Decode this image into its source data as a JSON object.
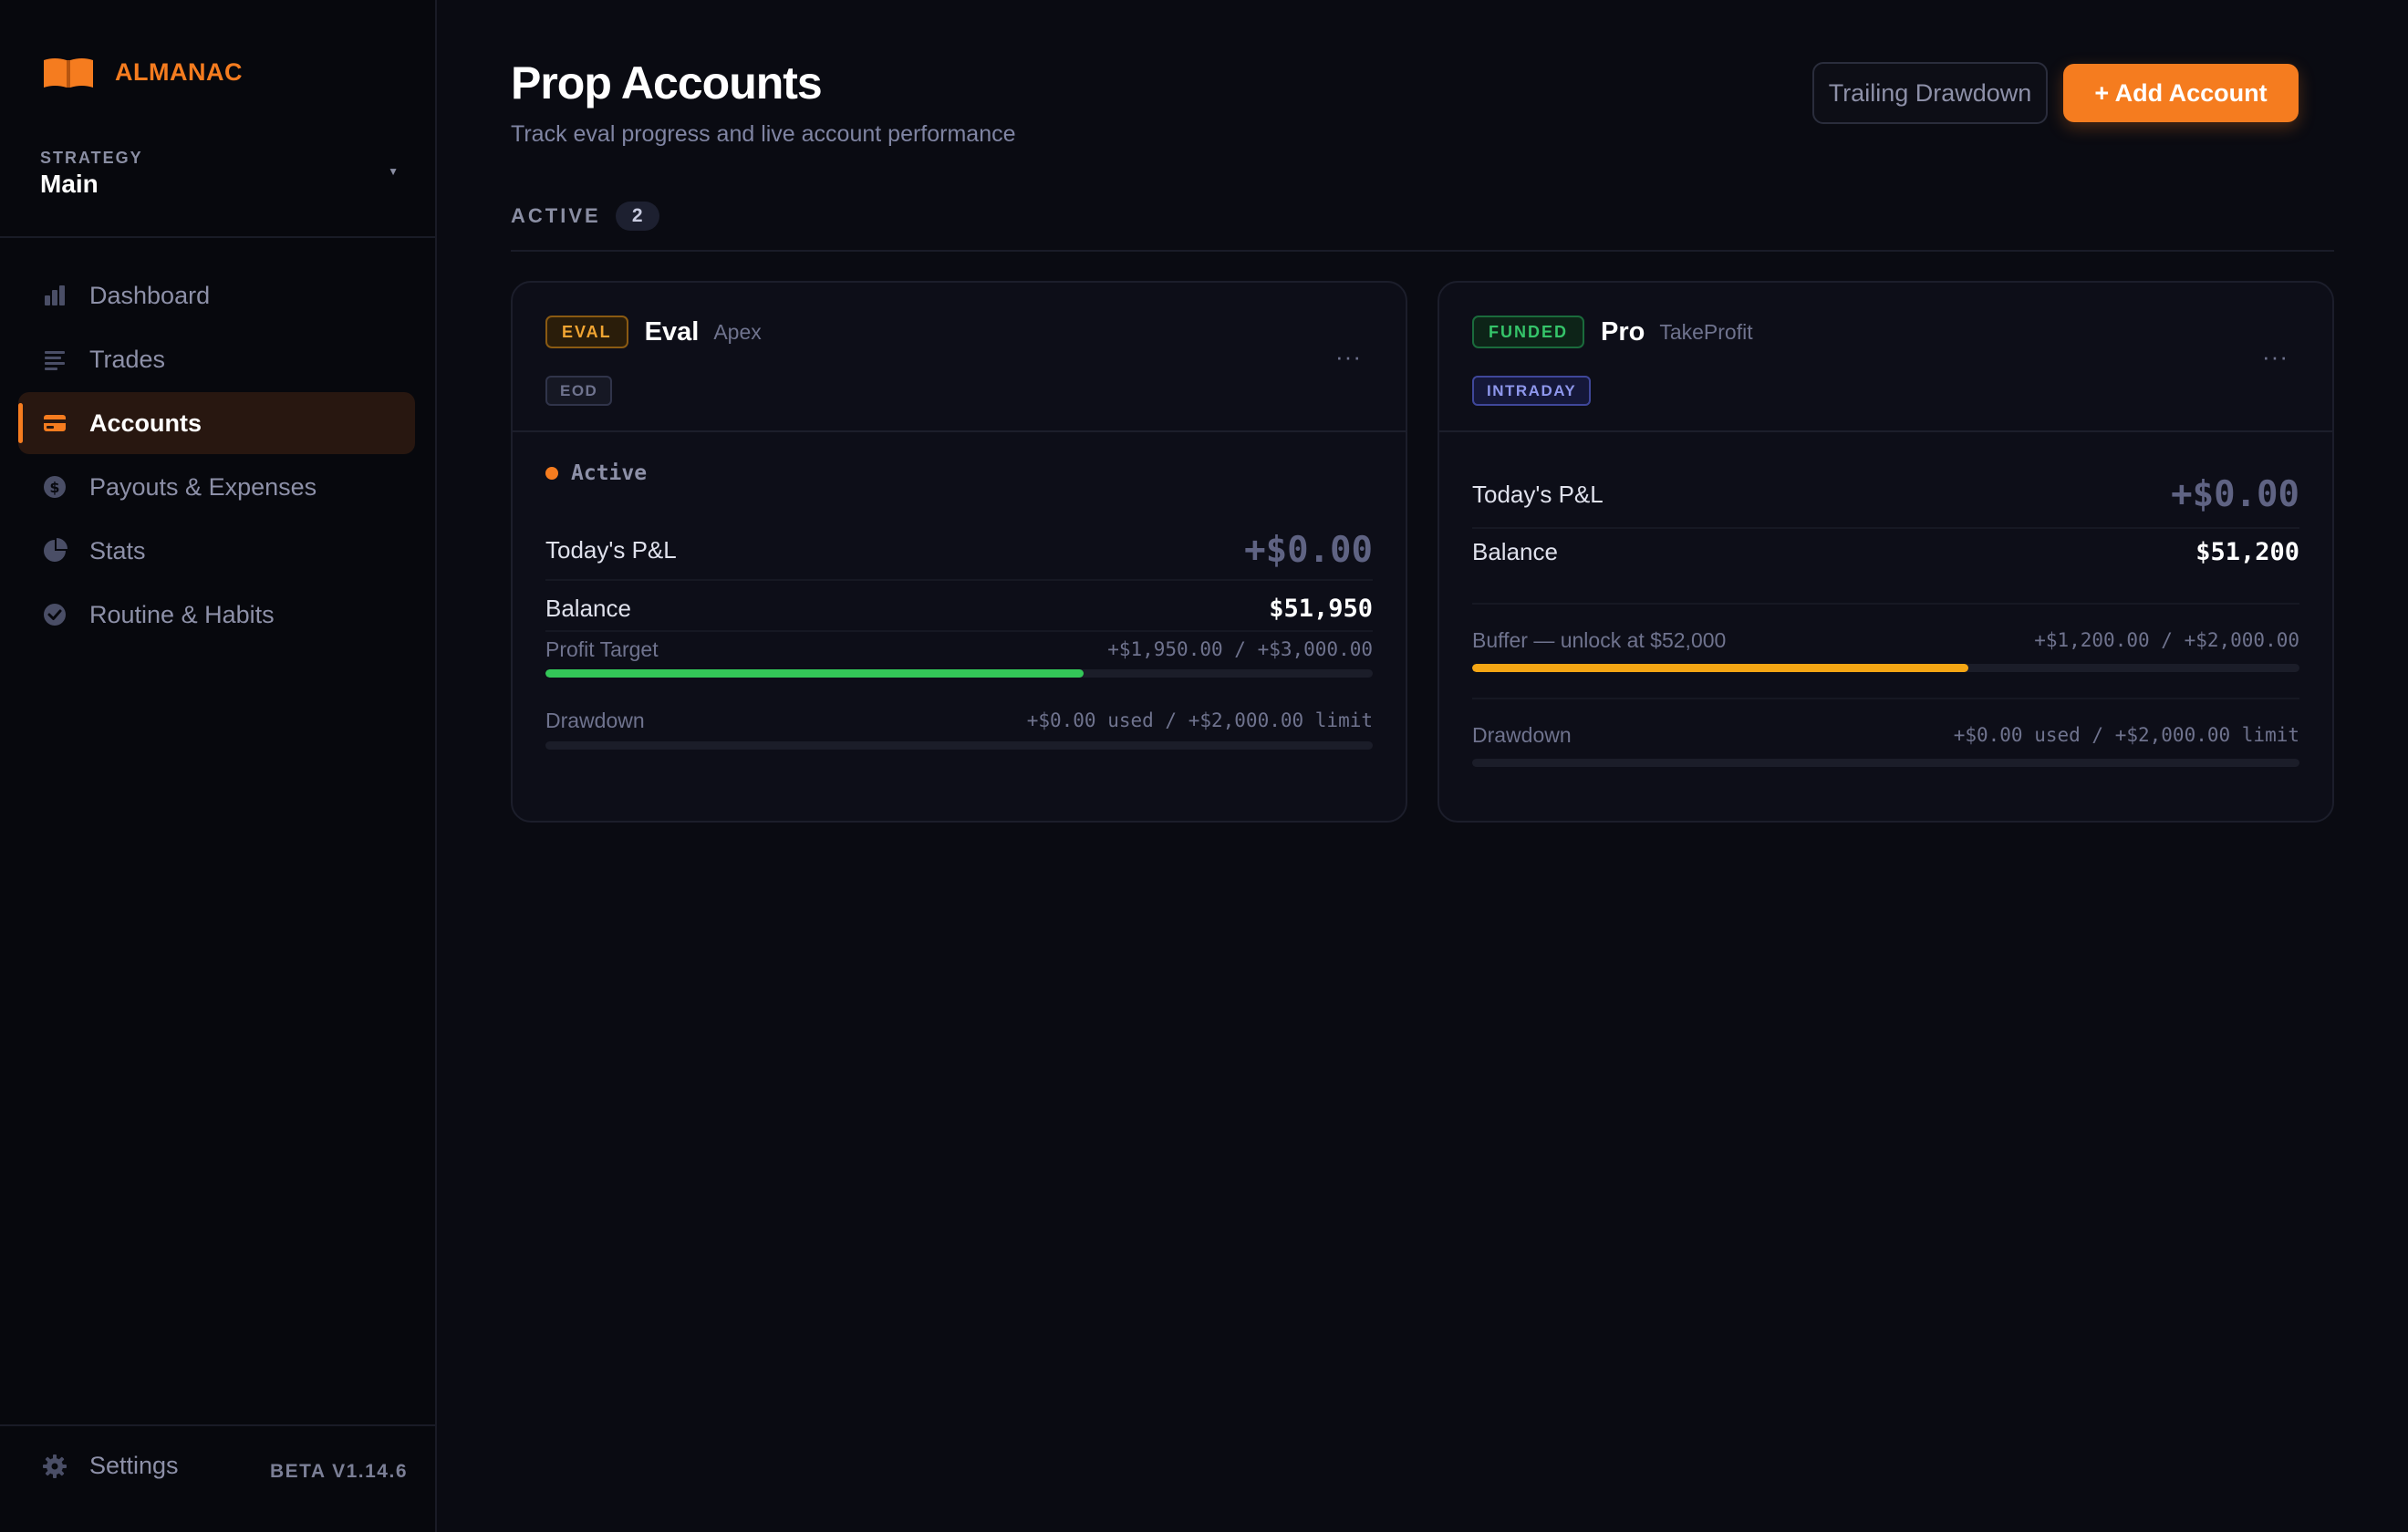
{
  "brand": {
    "name": "ALMANAC",
    "accent": "#f57c1f"
  },
  "strategy": {
    "label": "STRATEGY",
    "value": "Main"
  },
  "nav": [
    {
      "label": "Dashboard",
      "icon": "bar-chart-icon",
      "active": false
    },
    {
      "label": "Trades",
      "icon": "list-icon",
      "active": false
    },
    {
      "label": "Accounts",
      "icon": "credit-card-icon",
      "active": true
    },
    {
      "label": "Payouts & Expenses",
      "icon": "dollar-coin-icon",
      "active": false
    },
    {
      "label": "Stats",
      "icon": "pie-chart-icon",
      "active": false
    },
    {
      "label": "Routine & Habits",
      "icon": "check-circle-icon",
      "active": false
    }
  ],
  "settings": {
    "label": "Settings",
    "icon": "gear-icon"
  },
  "version": "BETA V1.14.6",
  "page": {
    "title": "Prop Accounts",
    "subtitle": "Track eval progress and live account performance"
  },
  "actions": {
    "trailing_drawdown": "Trailing Drawdown",
    "add_account": "+ Add Account"
  },
  "section": {
    "label": "ACTIVE",
    "count": "2"
  },
  "accounts": [
    {
      "badge": "EVAL",
      "name": "Eval",
      "firm": "Apex",
      "tag": "EOD",
      "menu": "···",
      "status": "Active",
      "pnl_label": "Today's P&L",
      "pnl_value": "+$0.00",
      "balance_label": "Balance",
      "balance_value": "$51,950",
      "progress_label": "Profit Target",
      "progress_value": "+$1,950.00 / +$3,000.00",
      "progress_fraction": 0.65,
      "progress_color": "#33c758",
      "drawdown_label": "Drawdown",
      "drawdown_value": "+$0.00 used / +$2,000.00 limit",
      "drawdown_fraction": 0
    },
    {
      "badge": "FUNDED",
      "name": "Pro",
      "firm": "TakeProfit",
      "tag": "INTRADAY",
      "menu": "···",
      "pnl_label": "Today's P&L",
      "pnl_value": "+$0.00",
      "balance_label": "Balance",
      "balance_value": "$51,200",
      "progress_label": "Buffer — unlock at $52,000",
      "progress_value": "+$1,200.00 / +$2,000.00",
      "progress_fraction": 0.6,
      "progress_color": "#f5a614",
      "drawdown_label": "Drawdown",
      "drawdown_value": "+$0.00 used / +$2,000.00 limit",
      "drawdown_fraction": 0
    }
  ]
}
